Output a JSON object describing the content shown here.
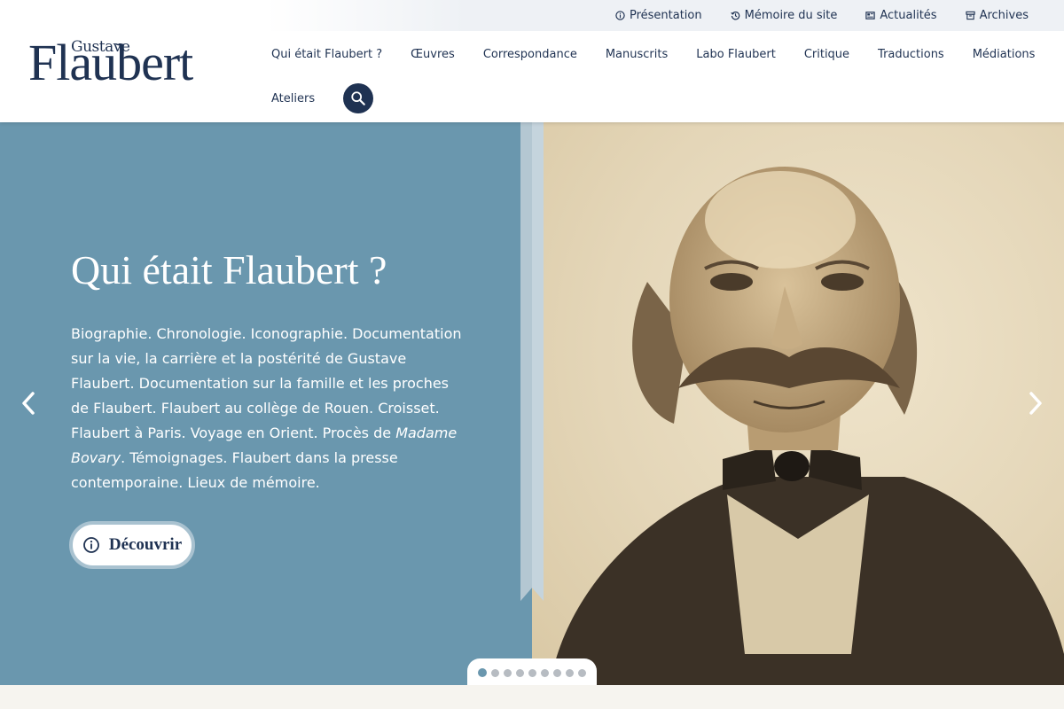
{
  "logo": {
    "small": "Gustave",
    "large": "Flaubert"
  },
  "topbar": {
    "links": [
      {
        "label": "Présentation",
        "icon": "info-icon"
      },
      {
        "label": "Mémoire du site",
        "icon": "history-icon"
      },
      {
        "label": "Actualités",
        "icon": "newspaper-icon"
      },
      {
        "label": "Archives",
        "icon": "archive-icon"
      }
    ]
  },
  "nav": {
    "items": [
      "Qui était Flaubert ?",
      "Œuvres",
      "Correspondance",
      "Manuscrits",
      "Labo Flaubert",
      "Critique",
      "Traductions",
      "Médiations",
      "Ateliers"
    ],
    "search_icon": "search-icon"
  },
  "hero": {
    "title": "Qui était Flaubert ?",
    "desc_part1": "Biographie. Chronologie. Iconographie. Documentation sur la vie, la carrière et la postérité de Gustave Flaubert. Documentation sur la famille et les proches de Flaubert. Flaubert au collège de Rouen. Croisset. Flaubert à Paris. Voyage en Orient. Procès de ",
    "desc_em": "Madame Bovary",
    "desc_part2": ". Témoignages. Flaubert dans la presse contemporaine. Lieux de mémoire.",
    "button_label": "Découvrir",
    "button_icon": "info-icon",
    "prev_icon": "chevron-left-icon",
    "next_icon": "chevron-right-icon"
  },
  "carousel": {
    "slide_count": 9,
    "active_index": 0
  },
  "colors": {
    "navy": "#1f3252",
    "panel": "#6a97ae",
    "ribbon": "#c5d4dd",
    "page_bg": "#f5f3ee"
  }
}
